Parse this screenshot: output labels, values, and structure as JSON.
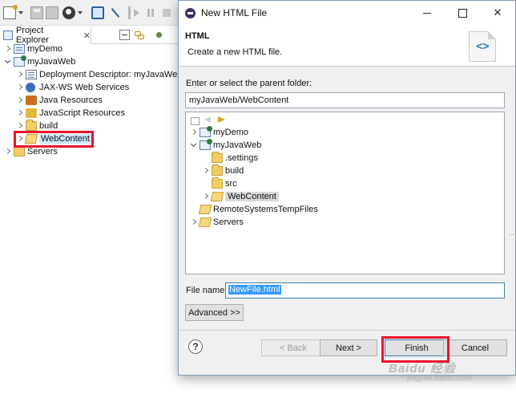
{
  "explorer": {
    "tab_label": "Project Explorer",
    "tab_close": "✕",
    "tree": [
      {
        "label": "myDemo",
        "icon": "project-icon",
        "state": "collapsed"
      },
      {
        "label": "myJavaWeb",
        "icon": "web-project-icon",
        "state": "expanded"
      },
      {
        "label": "Deployment Descriptor: myJavaWeb",
        "icon": "deployment-descriptor-icon",
        "state": "collapsed"
      },
      {
        "label": "JAX-WS Web Services",
        "icon": "jaxws-icon",
        "state": "collapsed"
      },
      {
        "label": "Java Resources",
        "icon": "java-resources-icon",
        "state": "collapsed"
      },
      {
        "label": "JavaScript Resources",
        "icon": "javascript-resources-icon",
        "state": "collapsed"
      },
      {
        "label": "build",
        "icon": "folder-icon",
        "state": "collapsed"
      },
      {
        "label": "WebContent",
        "icon": "folder-open-icon",
        "state": "collapsed",
        "selected": true
      },
      {
        "label": "Servers",
        "icon": "servers-icon",
        "state": "collapsed"
      }
    ]
  },
  "dialog": {
    "title": "New HTML File",
    "close_glyph": "✕",
    "banner_heading": "HTML",
    "banner_description": "Create a new HTML file.",
    "banner_icon_glyph": "<>",
    "folder_label": "Enter or select the parent folder:",
    "folder_value": "myJavaWeb/WebContent",
    "tree": [
      {
        "label": "myDemo",
        "state": "collapsed"
      },
      {
        "label": "myJavaWeb",
        "state": "expanded"
      },
      {
        "label": ".settings",
        "state": "leaf"
      },
      {
        "label": "build",
        "state": "collapsed"
      },
      {
        "label": "src",
        "state": "leaf"
      },
      {
        "label": "WebContent",
        "state": "collapsed",
        "selected": true
      },
      {
        "label": "RemoteSystemsTempFiles",
        "state": "leaf"
      },
      {
        "label": "Servers",
        "state": "collapsed"
      }
    ],
    "filename_label": "File name:",
    "filename_value": "NewFile.html",
    "advanced_label": "Advanced >>",
    "help_glyph": "?",
    "buttons": {
      "back": "< Back",
      "next": "Next >",
      "finish": "Finish",
      "cancel": "Cancel"
    }
  },
  "watermark": {
    "line1": "Baidu 经验",
    "line2": "jingyan.baidu.com"
  },
  "colors": {
    "highlight_box": "#e8142c",
    "selection": "#3399ff"
  }
}
